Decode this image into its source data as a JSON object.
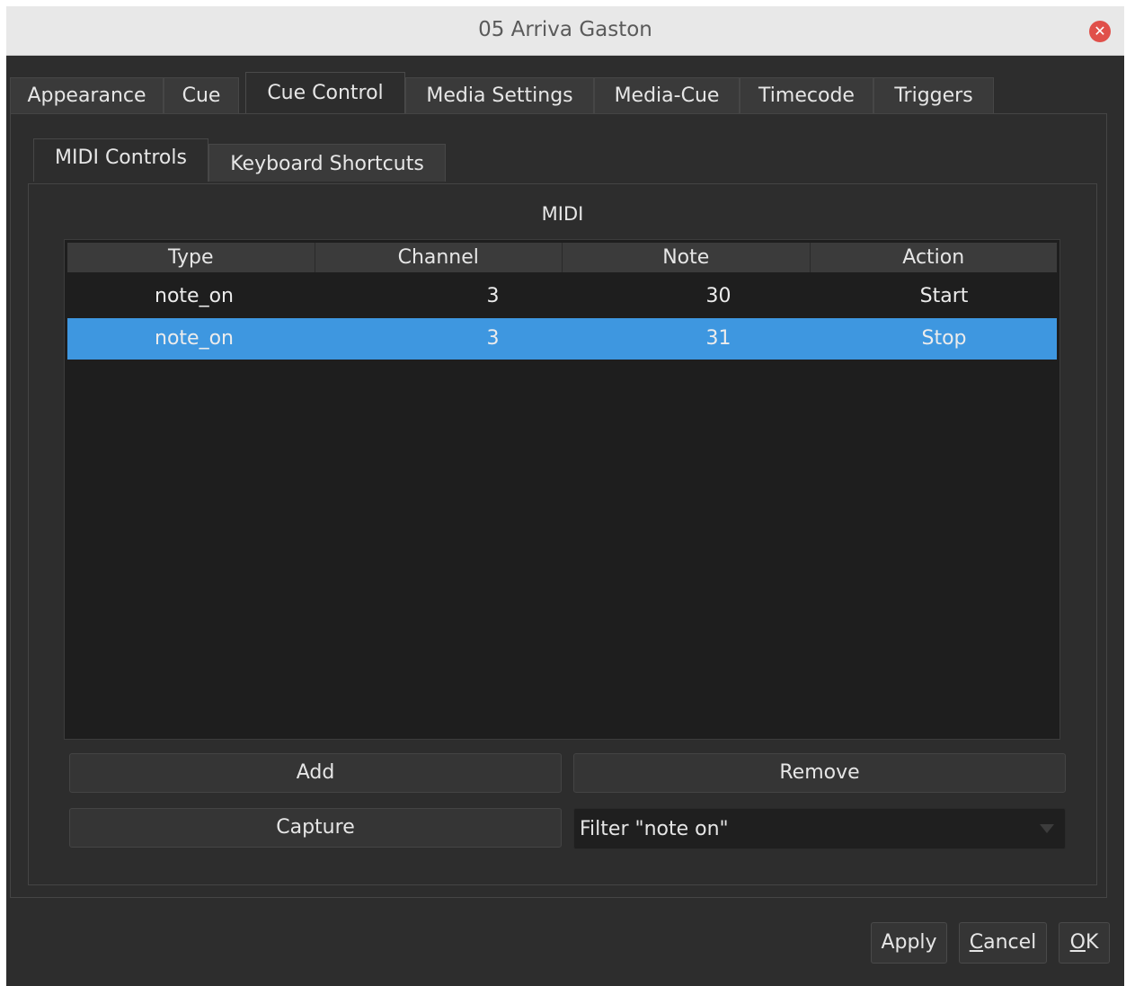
{
  "window": {
    "title": "05 Arriva Gaston"
  },
  "tabs": [
    {
      "label": "Appearance"
    },
    {
      "label": "Cue"
    },
    {
      "label": "Cue Control"
    },
    {
      "label": "Media Settings"
    },
    {
      "label": "Media-Cue"
    },
    {
      "label": "Timecode"
    },
    {
      "label": "Triggers"
    }
  ],
  "active_tab": "Cue Control",
  "subtabs": [
    {
      "label": "MIDI Controls"
    },
    {
      "label": "Keyboard Shortcuts"
    }
  ],
  "midi": {
    "title": "MIDI",
    "columns": [
      "Type",
      "Channel",
      "Note",
      "Action"
    ],
    "rows": [
      {
        "type": "note_on",
        "channel": "3",
        "note": "30",
        "action": "Start"
      },
      {
        "type": "note_on",
        "channel": "3",
        "note": "31",
        "action": "Stop"
      }
    ],
    "selected_row": 1,
    "add_label": "Add",
    "remove_label": "Remove",
    "capture_label": "Capture",
    "filter_value": "Filter \"note on\""
  },
  "footer": {
    "apply": "Apply",
    "cancel_mnemonic": "C",
    "cancel_rest": "ancel",
    "ok_mnemonic": "O",
    "ok_rest": "K"
  },
  "colors": {
    "selection": "#3e97e0",
    "close_button": "#e0504a",
    "background": "#2d2d2d"
  }
}
